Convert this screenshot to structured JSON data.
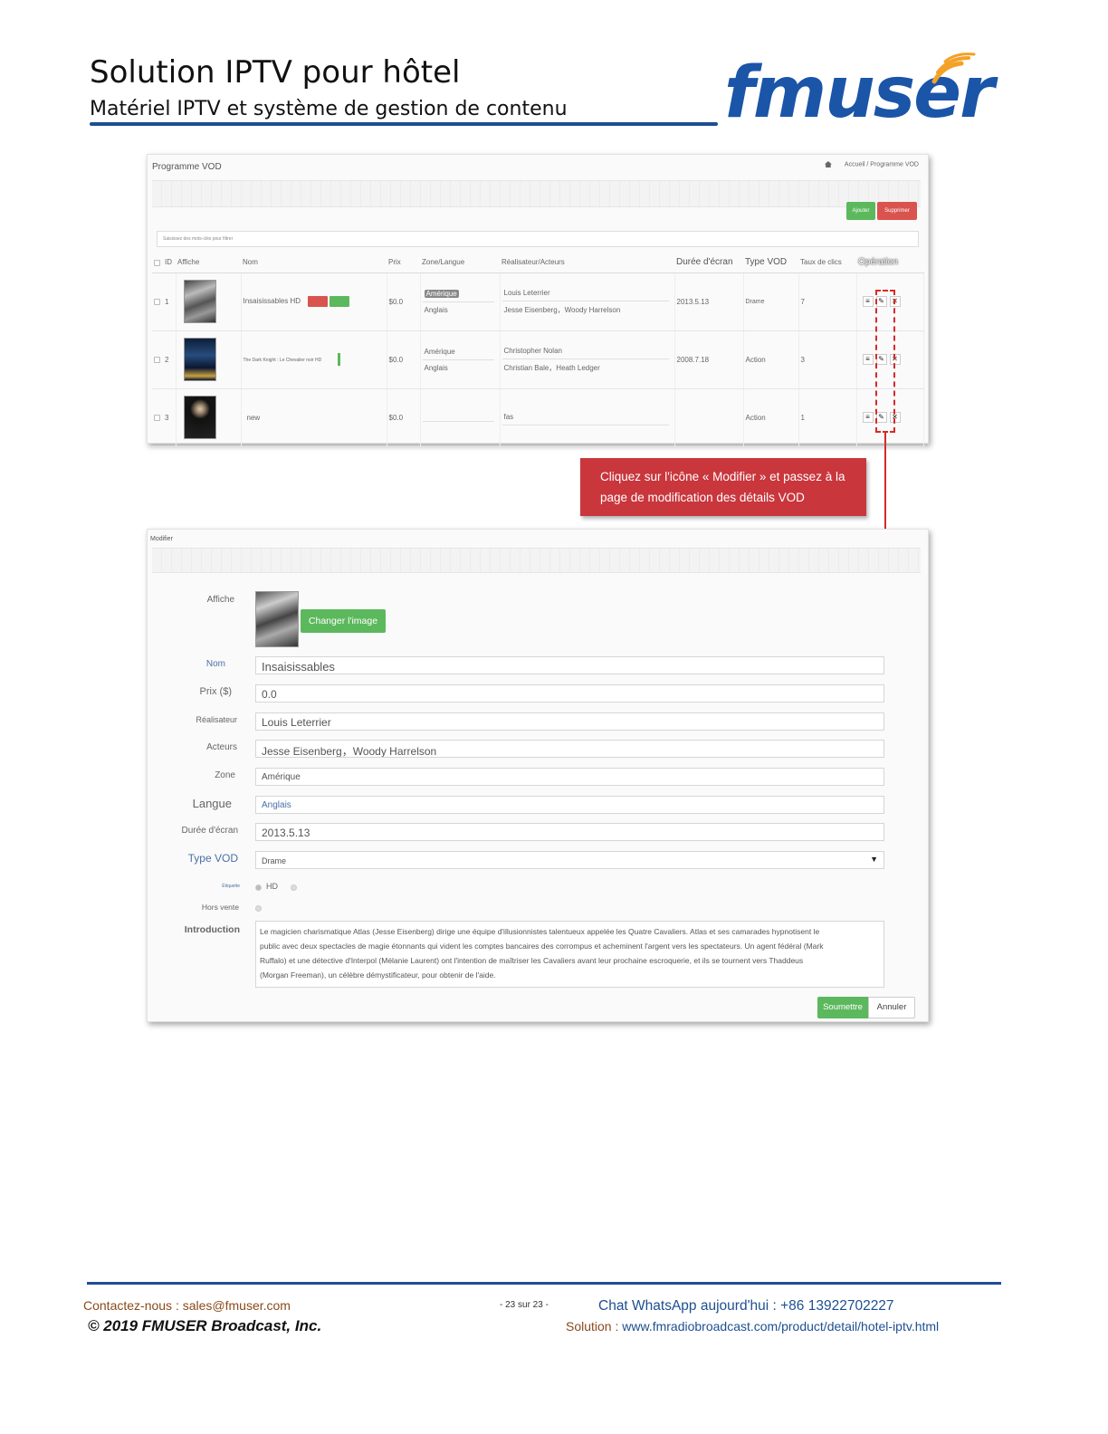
{
  "document": {
    "title": "Solution IPTV pour hôtel",
    "subtitle": "Matériel IPTV et système de gestion de contenu",
    "logo_text": "fmuser",
    "brand_color": "#1a55a8",
    "accent_color": "#f4a127"
  },
  "vod_list": {
    "title": "Programme VOD",
    "breadcrumb": "Accueil / Programme VOD",
    "add_button": "Ajouter",
    "delete_button": "Supprimer",
    "filter_placeholder": "Saisissez des mots-clés pour filtrer",
    "columns": [
      "ID",
      "Affiche",
      "Nom",
      "Prix",
      "Zone/Langue",
      "Réalisateur/Acteurs",
      "Durée d'écran",
      "Type VOD",
      "Taux de clics",
      "Opération"
    ],
    "rows": [
      {
        "id": "1",
        "name": "Insaisissables HD",
        "price": "$0.0",
        "zone": "Amérique",
        "language": "Anglais",
        "director": "Louis Leterrier",
        "actors": "Jesse Eisenberg，Woody Harrelson",
        "duration": "2013.5.13",
        "type": "Drame",
        "clicks": "7"
      },
      {
        "id": "2",
        "name": "The Dark Knight : Le Chevalier noir HD",
        "price": "$0.0",
        "zone": "Amérique",
        "language": "Anglais",
        "director": "Christopher Nolan",
        "actors": "Christian Bale，Heath Ledger",
        "duration": "2008.7.18",
        "type": "Action",
        "clicks": "3"
      },
      {
        "id": "3",
        "name": "new",
        "price": "$0.0",
        "zone": "",
        "language": "",
        "director": "fas",
        "actors": "",
        "duration": "",
        "type": "Action",
        "clicks": "1"
      }
    ]
  },
  "callout": {
    "text": "Cliquez sur l'icône « Modifier » et passez à la page de modification des détails VOD"
  },
  "edit_form": {
    "title": "Modifier",
    "labels": {
      "poster": "Affiche",
      "name": "Nom",
      "price": "Prix ($)",
      "director": "Réalisateur",
      "actors": "Acteurs",
      "zone": "Zone",
      "language": "Langue",
      "duration": "Durée d'écran",
      "type": "Type VOD",
      "tag": "Étiquette",
      "not_for_sale": "Hors vente",
      "introduction": "Introduction"
    },
    "change_image_button": "Changer l'image",
    "values": {
      "name": "Insaisissables",
      "price": "0.0",
      "director": "Louis Leterrier",
      "actors": "Jesse Eisenberg，Woody Harrelson",
      "zone": "Amérique",
      "language": "Anglais",
      "duration": "2013.5.13",
      "type": "Drame",
      "tag": "HD",
      "introduction": "Le magicien charismatique Atlas (Jesse Eisenberg) dirige une équipe d'illusionnistes talentueux appelée les Quatre Cavaliers. Atlas et ses camarades hypnotisent le public avec deux spectacles de magie étonnants qui vident les comptes bancaires des corrompus et acheminent l'argent vers les spectateurs. Un agent fédéral (Mark Ruffalo) et une détective d'Interpol (Mélanie Laurent) ont l'intention de maîtriser les Cavaliers avant leur prochaine escroquerie, et ils se tournent vers Thaddeus (Morgan Freeman), un célèbre démystificateur, pour obtenir de l'aide."
    },
    "submit_button": "Soumettre",
    "cancel_button": "Annuler"
  },
  "footer": {
    "contact": "Contactez-nous : sales@fmuser.com",
    "copyright": "© 2019 FMUSER Broadcast, Inc.",
    "page": "- 23 sur 23 -",
    "chat": "Chat WhatsApp aujourd'hui : +86 13922702227",
    "solution_label": "Solution : ",
    "solution_url": "www.fmradiobroadcast.com/product/detail/hotel-iptv.html"
  }
}
